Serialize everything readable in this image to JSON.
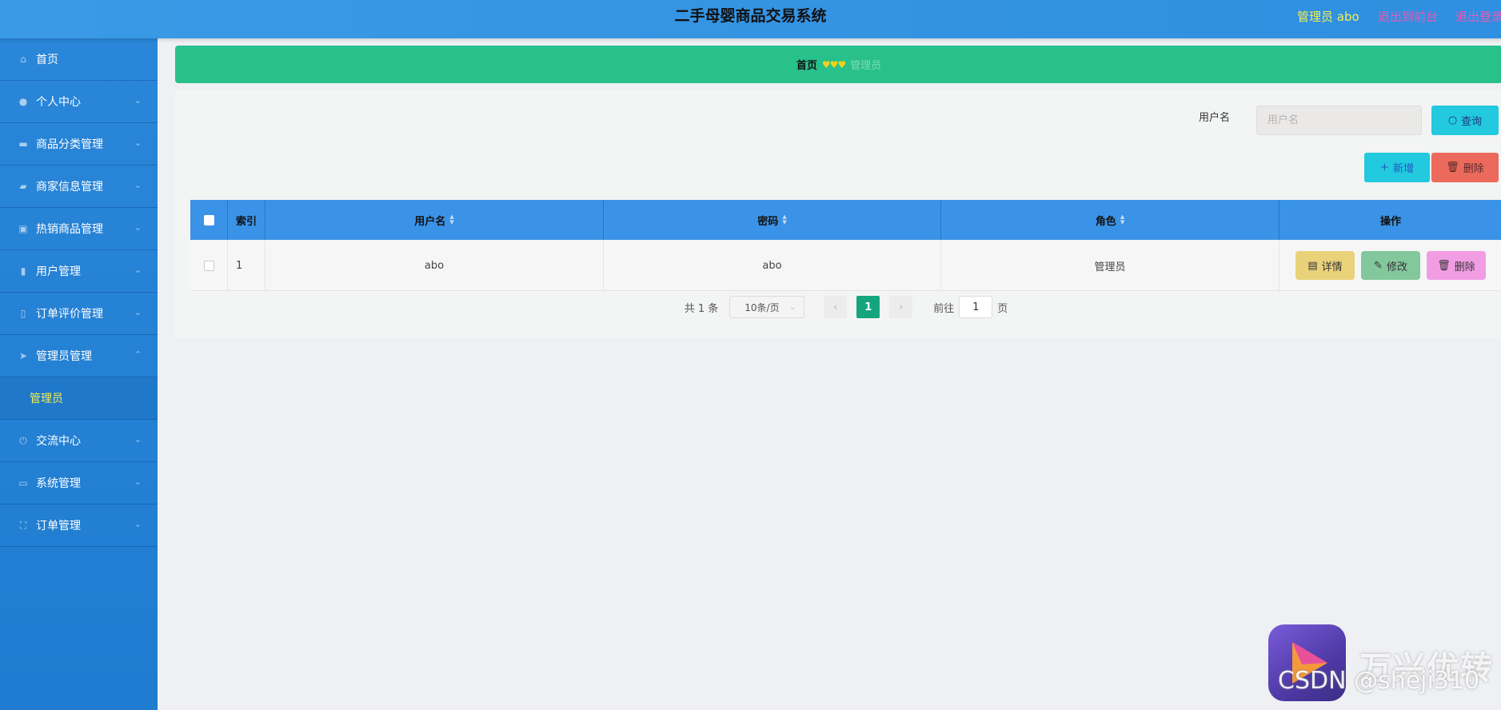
{
  "header": {
    "title": "二手母婴商品交易系统",
    "user": "管理员 abo",
    "back_front": "退出到前台",
    "logout": "退出登录"
  },
  "sidebar": {
    "items": [
      {
        "label": "首页",
        "icon": "home-icon"
      },
      {
        "label": "个人中心",
        "icon": "user-icon"
      },
      {
        "label": "商品分类管理",
        "icon": "comment-icon"
      },
      {
        "label": "商家信息管理",
        "icon": "ticket-icon"
      },
      {
        "label": "热销商品管理",
        "icon": "clipboard-icon"
      },
      {
        "label": "用户管理",
        "icon": "mic-icon"
      },
      {
        "label": "订单评价管理",
        "icon": "medal-icon"
      },
      {
        "label": "管理员管理",
        "icon": "send-icon",
        "expanded": true
      },
      {
        "label": "交流中心",
        "icon": "power-icon"
      },
      {
        "label": "系统管理",
        "icon": "message-icon"
      },
      {
        "label": "订单管理",
        "icon": "fullscreen-icon"
      }
    ],
    "submenu_label": "管理员"
  },
  "breadcrumb": {
    "home": "首页",
    "separator": "♥♥♥",
    "current": "管理员"
  },
  "search": {
    "label": "用户名",
    "placeholder": "用户名",
    "query_label": "查询"
  },
  "actions": {
    "add_label": "新增",
    "delete_label": "删除"
  },
  "table": {
    "headers": {
      "index": "索引",
      "username": "用户名",
      "password": "密码",
      "role": "角色",
      "operation": "操作"
    },
    "rows": [
      {
        "index": "1",
        "username": "abo",
        "password": "abo",
        "role": "管理员"
      }
    ],
    "row_actions": {
      "detail": "详情",
      "edit": "修改",
      "delete": "删除"
    }
  },
  "pagination": {
    "total": "共 1 条",
    "page_size": "10条/页",
    "current_page": "1",
    "goto_prefix": "前往",
    "goto_value": "1",
    "goto_suffix": "页"
  },
  "watermark": {
    "brand": "万兴优转",
    "csdn": "CSDN @sheji310"
  },
  "colors": {
    "header_bg": "#3a9ae6",
    "sidebar_bg": "#2a86d8",
    "breadcrumb_bg": "#28c08b",
    "table_header_bg": "#3a93e6",
    "accent_yellow": "#f2ef55",
    "link_pink": "#e45bb6"
  }
}
